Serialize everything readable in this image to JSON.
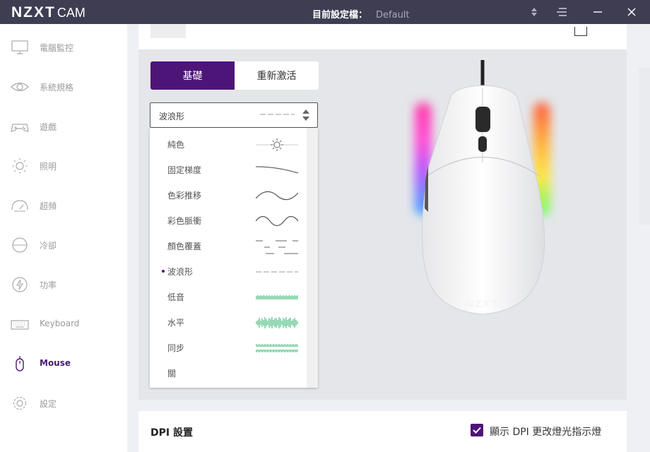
{
  "titlebar": {
    "logo_main": "NZXT",
    "logo_sub": "CAM",
    "profile_label": "目前設定檔：",
    "profile_value": "Default"
  },
  "sidebar": {
    "items": [
      {
        "label": "電腦監控",
        "icon": "monitor-icon"
      },
      {
        "label": "系統規格",
        "icon": "eye-icon"
      },
      {
        "label": "遊戲",
        "icon": "gamepad-icon"
      },
      {
        "label": "照明",
        "icon": "sun-icon"
      },
      {
        "label": "超頻",
        "icon": "speedometer-icon"
      },
      {
        "label": "冷卻",
        "icon": "cooling-icon"
      },
      {
        "label": "功率",
        "icon": "power-icon"
      },
      {
        "label": "Keyboard",
        "icon": "keyboard-icon"
      },
      {
        "label": "Mouse",
        "icon": "mouse-icon",
        "active": true
      },
      {
        "label": "設定",
        "icon": "gear-icon"
      }
    ]
  },
  "lighting": {
    "tab_basic": "基礎",
    "tab_reactive": "重新激活",
    "selected_effect": "波浪形",
    "options": [
      {
        "label": "純色",
        "preview": "fixed-preview-icon"
      },
      {
        "label": "固定梯度",
        "preview": "gradient-preview-icon"
      },
      {
        "label": "色彩推移",
        "preview": "wave-preview-icon"
      },
      {
        "label": "彩色脈衝",
        "preview": "pulse-preview-icon"
      },
      {
        "label": "顏色覆蓋",
        "preview": "cover-preview-icon"
      },
      {
        "label": "波浪形",
        "preview": "marquee-preview-icon",
        "selected": true
      },
      {
        "label": "低音",
        "preview": "bass-preview-icon"
      },
      {
        "label": "水平",
        "preview": "level-preview-icon"
      },
      {
        "label": "同步",
        "preview": "sync-preview-icon"
      },
      {
        "label": "關",
        "preview": ""
      }
    ]
  },
  "dpi": {
    "title": "DPI 設置",
    "checkbox_label": "顯示 DPI 更改燈光指示燈",
    "checkbox_checked": true
  },
  "colors": {
    "accent": "#4e1578",
    "titlebar": "#3e3d52",
    "wave_green": "#2fb36b"
  }
}
